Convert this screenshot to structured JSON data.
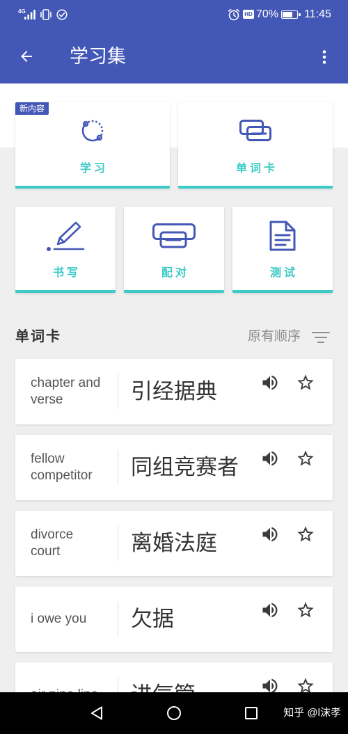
{
  "colors": {
    "brand_blue": "#4357b6",
    "accent_teal": "#3ccbc6",
    "icon_indigo": "#4357b6",
    "page_gray": "#efefef"
  },
  "status_bar": {
    "network": "4G",
    "left_icons": [
      "signal-icon",
      "vibrate-icon",
      "check-circle-icon"
    ],
    "right_icons": [
      "alarm-icon",
      "hd-icon",
      "battery-icon"
    ],
    "hd_badge": "HD",
    "battery_percent": "70%",
    "time": "11:45"
  },
  "app_bar": {
    "back_icon": "arrow-back-icon",
    "title": "学习集",
    "menu_icon": "more-vert-icon"
  },
  "study_modes": [
    {
      "label": "学习",
      "badge": "新内容",
      "icon": "learn-icon"
    },
    {
      "label": "单词卡",
      "icon": "flashcards-icon"
    },
    {
      "label": "书写",
      "icon": "write-icon"
    },
    {
      "label": "配对",
      "icon": "match-icon"
    },
    {
      "label": "测试",
      "icon": "test-icon"
    }
  ],
  "terms_section": {
    "title": "单词卡",
    "sort_label": "原有顺序",
    "sort_icon": "sort-icon"
  },
  "terms": [
    {
      "term": "chapter and verse",
      "definition": "引经据典"
    },
    {
      "term": "fellow competitor",
      "definition": "同组竞赛者"
    },
    {
      "term": "divorce court",
      "definition": "离婚法庭"
    },
    {
      "term": "i owe you",
      "definition": "欠据"
    },
    {
      "term": "air pipe line",
      "definition": "进气管"
    }
  ],
  "term_actions": [
    "speaker-icon",
    "star-outline-icon"
  ],
  "nav_bar": {
    "buttons": [
      "back-nav-icon",
      "home-nav-icon",
      "recents-nav-icon"
    ],
    "watermark": "知乎 @l沫孝"
  }
}
